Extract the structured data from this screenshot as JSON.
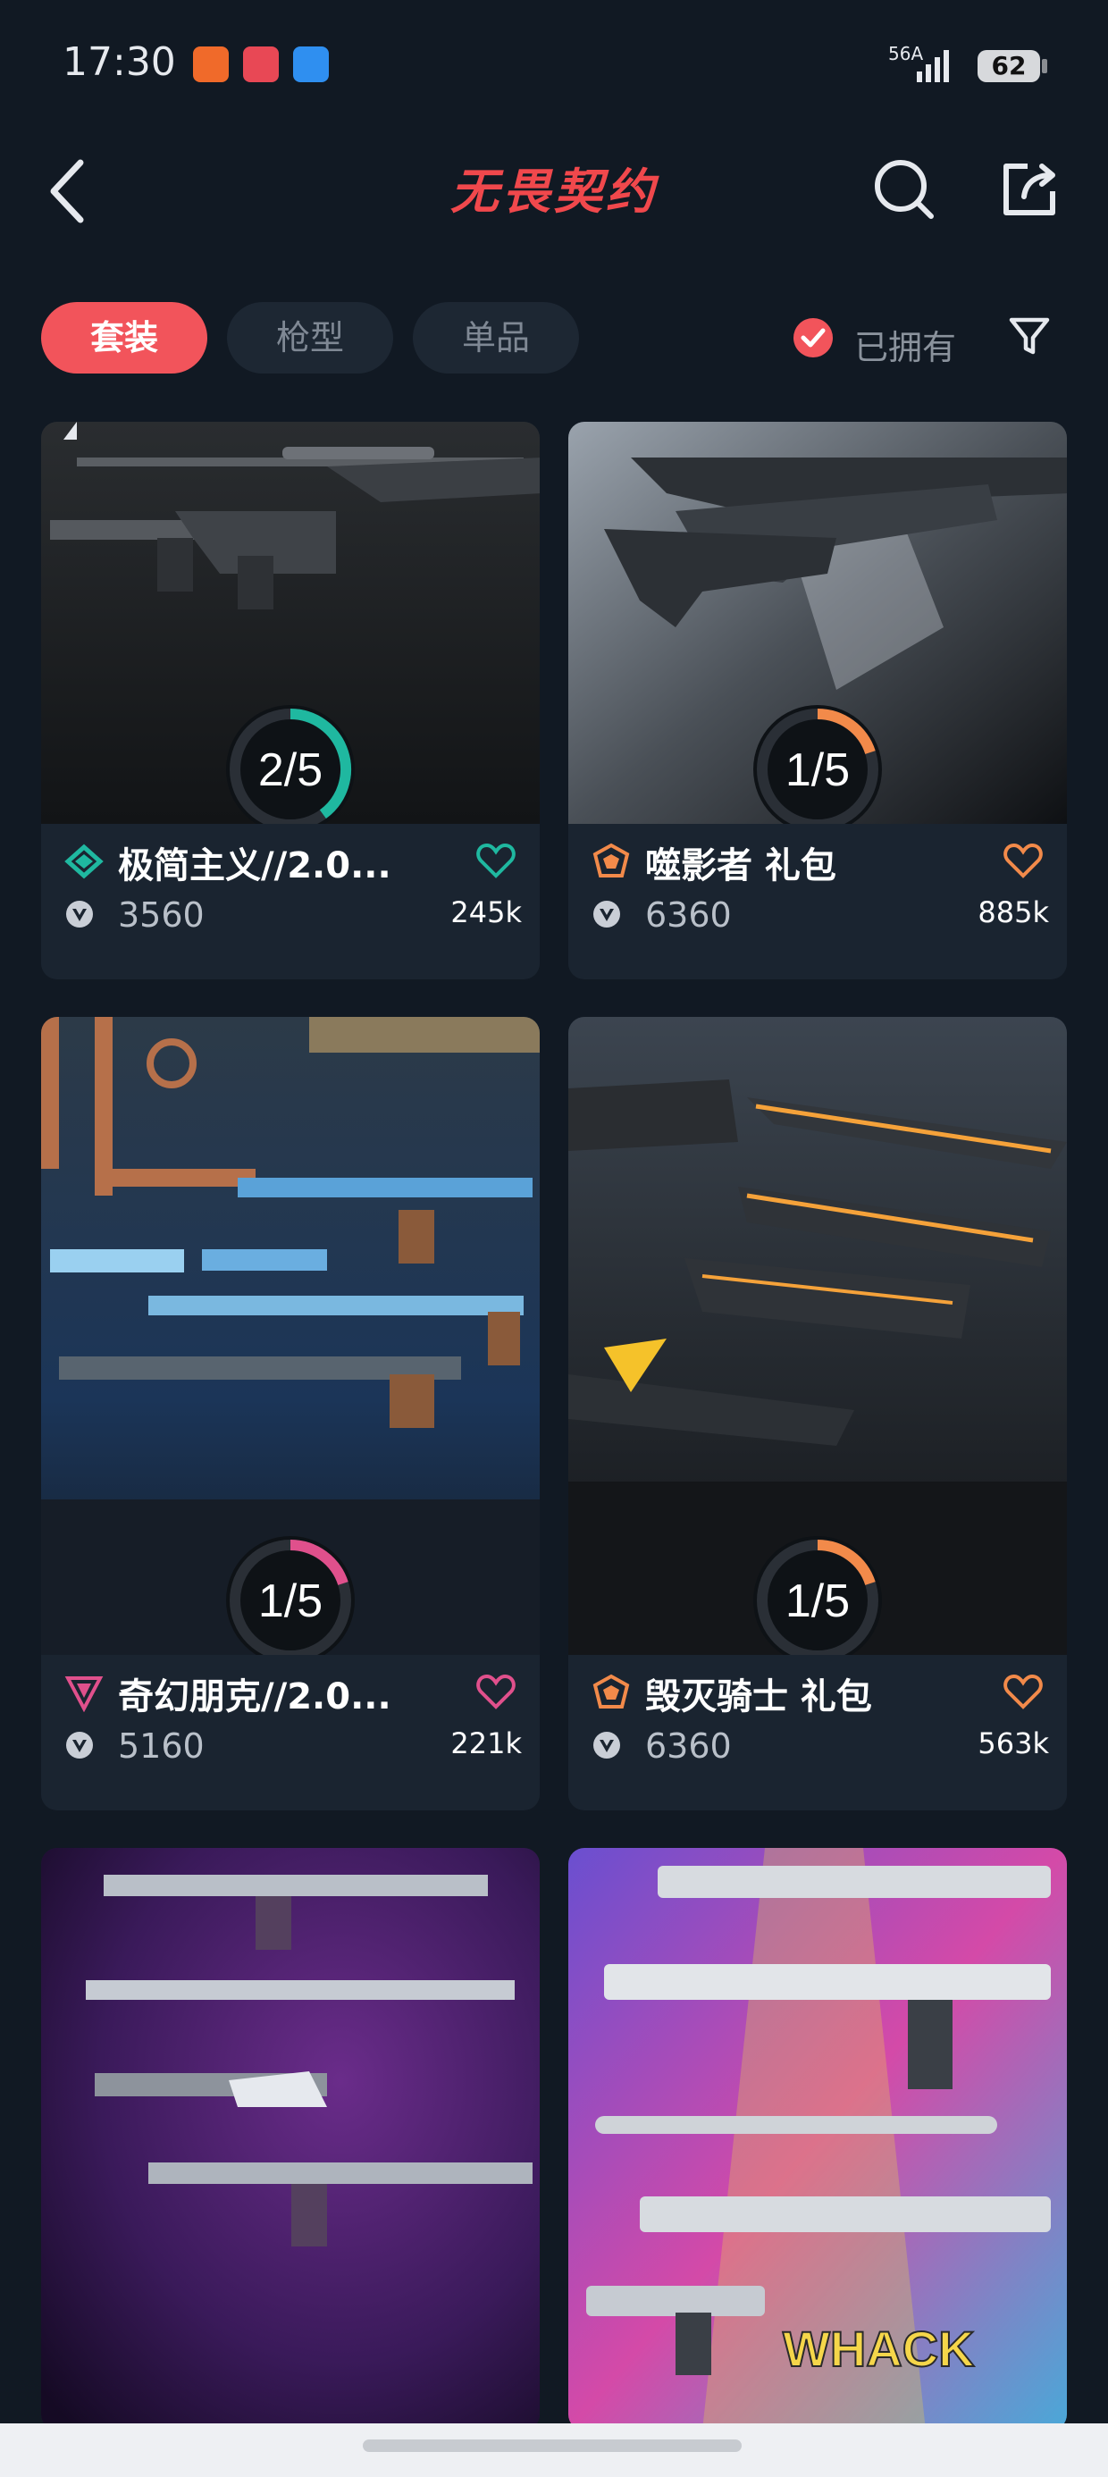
{
  "status_bar": {
    "time": "17:30",
    "network": "56A",
    "battery": "62"
  },
  "header": {
    "title": "无畏契约"
  },
  "filters": {
    "tabs": [
      "套装",
      "枪型",
      "单品"
    ],
    "active_tab": "套装",
    "owned_label": "已拥有"
  },
  "colors": {
    "accent": "#f2545b",
    "teal": "#1fb8a0",
    "orange": "#f28a4a",
    "pink": "#e0508c",
    "background": "#111923",
    "card": "#1a2430"
  },
  "cards": [
    {
      "name": "极简主义//2.0...",
      "price": "3560",
      "likes": "245k",
      "owned": "2/5",
      "owned_fraction": 0.4,
      "rarity": "teal",
      "rarity_icon": "select-edition-icon"
    },
    {
      "name": "噬影者 礼包",
      "price": "6360",
      "likes": "885k",
      "owned": "1/5",
      "owned_fraction": 0.2,
      "rarity": "orange",
      "rarity_icon": "exclusive-edition-icon"
    },
    {
      "name": "奇幻朋克//2.0...",
      "price": "5160",
      "likes": "221k",
      "owned": "1/5",
      "owned_fraction": 0.2,
      "rarity": "pink",
      "rarity_icon": "premium-edition-icon"
    },
    {
      "name": "毁灭骑士 礼包",
      "price": "6360",
      "likes": "563k",
      "owned": "1/5",
      "owned_fraction": 0.2,
      "rarity": "orange",
      "rarity_icon": "exclusive-edition-icon"
    },
    {
      "name": "",
      "price": "",
      "likes": "",
      "owned": "",
      "rarity": "orange"
    },
    {
      "name": "",
      "price": "",
      "likes": "",
      "owned": "",
      "rarity": "pink"
    }
  ]
}
